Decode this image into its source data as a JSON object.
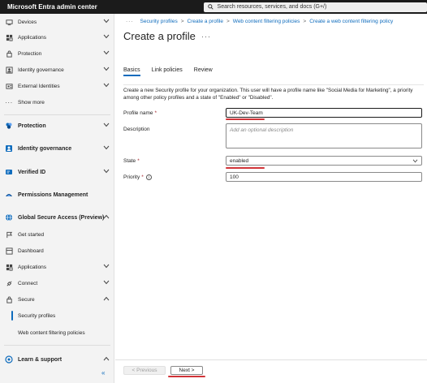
{
  "app": {
    "title": "Microsoft Entra admin center",
    "search_placeholder": "Search resources, services, and docs (G+/)"
  },
  "sidebar": {
    "items": [
      {
        "label": "Devices",
        "icon": "devices-icon",
        "expandable": true
      },
      {
        "label": "Applications",
        "icon": "applications-icon",
        "expandable": true
      },
      {
        "label": "Protection",
        "icon": "protection-icon",
        "expandable": true
      },
      {
        "label": "Identity governance",
        "icon": "identity-governance-icon",
        "expandable": true
      },
      {
        "label": "External Identities",
        "icon": "external-identities-icon",
        "expandable": true
      },
      {
        "label": "Show more",
        "icon": "more-icon",
        "expandable": false
      }
    ],
    "sections": [
      {
        "label": "Protection",
        "icon": "protection-section-icon"
      },
      {
        "label": "Identity governance",
        "icon": "identity-governance-section-icon"
      },
      {
        "label": "Verified ID",
        "icon": "verified-id-icon"
      },
      {
        "label": "Permissions Management",
        "icon": "permissions-management-icon"
      },
      {
        "label": "Global Secure Access (Preview)",
        "icon": "global-secure-access-icon"
      }
    ],
    "gsa_items": [
      {
        "label": "Get started",
        "icon": "flag-icon"
      },
      {
        "label": "Dashboard",
        "icon": "dashboard-icon"
      },
      {
        "label": "Applications",
        "icon": "applications-icon"
      },
      {
        "label": "Connect",
        "icon": "connect-icon"
      },
      {
        "label": "Secure",
        "icon": "secure-icon"
      }
    ],
    "secure_sub": [
      {
        "label": "Security profiles",
        "active": true
      },
      {
        "label": "Web content filtering policies",
        "active": false
      }
    ],
    "learn": {
      "label": "Learn & support",
      "icon": "learn-support-icon"
    },
    "collapse_glyph": "«"
  },
  "breadcrumb": {
    "ellipsis": "···",
    "items": [
      "Security profiles",
      "Create a profile",
      "Web content filtering policies",
      "Create a web content filtering policy"
    ],
    "separator": ">"
  },
  "page": {
    "title": "Create a profile",
    "more": "···"
  },
  "tabs": [
    "Basics",
    "Link policies",
    "Review"
  ],
  "description": "Create a new Security profile for your organization. This user will have a profile name like \"Social Media for Marketing\", a priority among other policy profiles and a state of \"Enabled\" or \"Disabled\".",
  "form": {
    "profile_name_label": "Profile name",
    "profile_name_value": "UK-Dev-Team",
    "description_label": "Description",
    "description_placeholder": "Add an optional description",
    "state_label": "State",
    "state_value": "enabled",
    "priority_label": "Priority",
    "priority_value": "100",
    "required_mark": "*"
  },
  "footer": {
    "previous_label": "< Previous",
    "next_label": "Next >"
  },
  "colors": {
    "accent": "#0f6cbd",
    "annotation": "#d13438",
    "topbar": "#1b1b1b"
  }
}
